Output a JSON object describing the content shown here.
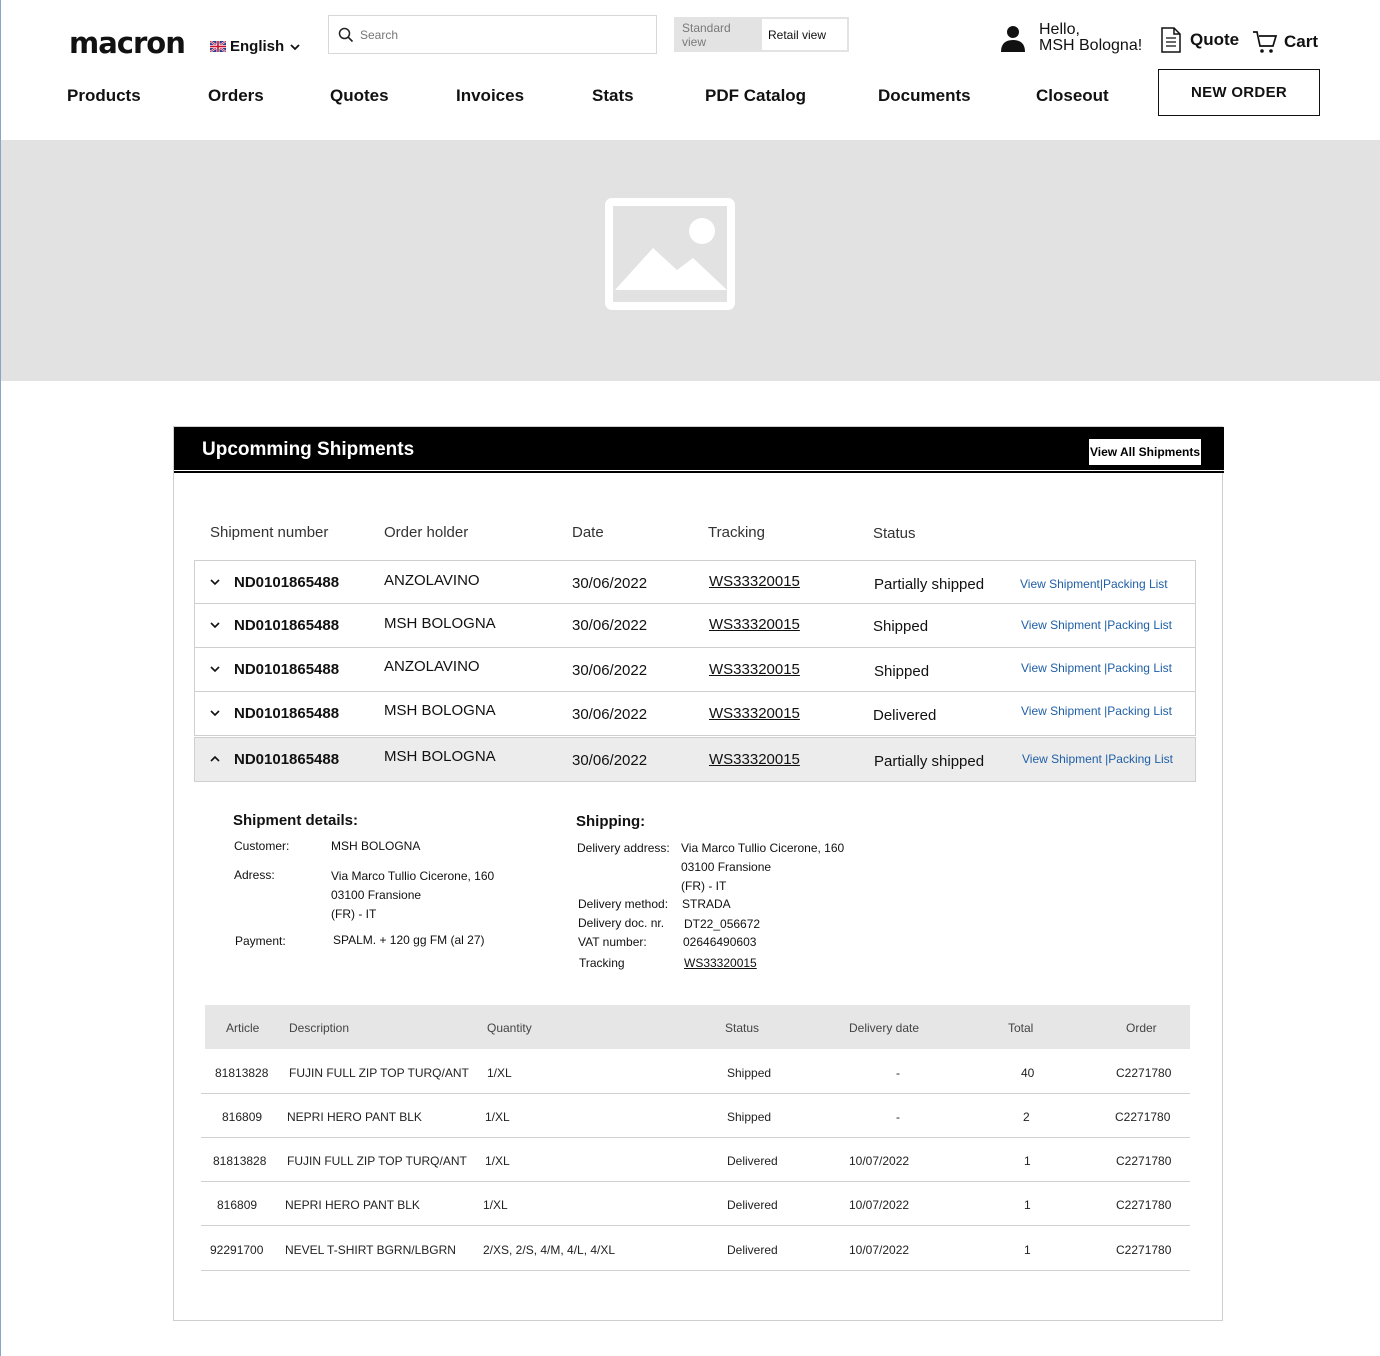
{
  "header": {
    "logo": "macron",
    "language": "English",
    "search_placeholder": "Search",
    "view_standard": "Standard view",
    "view_retail": "Retail view",
    "greeting_line1": "Hello,",
    "greeting_line2": "MSH Bologna!",
    "quote_label": "Quote",
    "cart_label": "Cart",
    "new_order_label": "NEW ORDER"
  },
  "nav": {
    "items": [
      "Products",
      "Orders",
      "Quotes",
      "Invoices",
      "Stats",
      "PDF Catalog",
      "Documents",
      "Closeout"
    ]
  },
  "shipments": {
    "title": "Upcomming Shipments",
    "view_all_label": "View All Shipments",
    "columns": [
      "Shipment number",
      "Order holder",
      "Date",
      "Tracking",
      "Status"
    ],
    "rows": [
      {
        "number": "ND0101865488",
        "holder": "ANZOLAVINO",
        "date": "30/06/2022",
        "tracking": "WS33320015",
        "status": "Partially shipped",
        "view_link": "View Shipment",
        "packing_link": "|Packing List"
      },
      {
        "number": "ND0101865488",
        "holder": "MSH BOLOGNA",
        "date": "30/06/2022",
        "tracking": "WS33320015",
        "status": "Shipped",
        "view_link": "View Shipment",
        "packing_link": "|Packing List"
      },
      {
        "number": "ND0101865488",
        "holder": "ANZOLAVINO",
        "date": "30/06/2022",
        "tracking": "WS33320015",
        "status": "Shipped",
        "view_link": "View Shipment",
        "packing_link": "|Packing List"
      },
      {
        "number": "ND0101865488",
        "holder": "MSH BOLOGNA",
        "date": "30/06/2022",
        "tracking": "WS33320015",
        "status": "Delivered",
        "view_link": "View Shipment",
        "packing_link": "|Packing List"
      },
      {
        "number": "ND0101865488",
        "holder": "MSH BOLOGNA",
        "date": "30/06/2022",
        "tracking": "WS33320015",
        "status": "Partially shipped",
        "view_link": "View Shipment",
        "packing_link": "|Packing List"
      }
    ],
    "details": {
      "title": "Shipment details:",
      "customer_label": "Customer:",
      "customer": "MSH BOLOGNA",
      "address_label": "Adress:",
      "address_line1": "Via Marco Tullio Cicerone, 160",
      "address_line2": "03100 Fransione",
      "address_line3": "(FR) - IT",
      "payment_label": "Payment:",
      "payment": "SPALM. + 120 gg FM (al 27)"
    },
    "shipping": {
      "title": "Shipping:",
      "delivery_address_label": "Delivery address:",
      "delivery_address_line1": "Via Marco Tullio Cicerone, 160",
      "delivery_address_line2": "03100 Fransione",
      "delivery_address_line3": "(FR) - IT",
      "delivery_method_label": "Delivery method:",
      "delivery_method": "STRADA",
      "delivery_doc_label": "Delivery doc. nr.",
      "delivery_doc": "DT22_056672",
      "vat_label": "VAT number:",
      "vat": "02646490603",
      "tracking_label": "Tracking",
      "tracking": "WS33320015"
    },
    "items": {
      "columns": [
        "Article",
        "Description",
        "Quantity",
        "Status",
        "Delivery date",
        "Total",
        "Order"
      ],
      "rows": [
        {
          "article": "81813828",
          "description": "FUJIN FULL ZIP TOP TURQ/ANT",
          "quantity": "1/XL",
          "status": "Shipped",
          "delivery_date": "-",
          "total": "40",
          "order": "C2271780"
        },
        {
          "article": "816809",
          "description": "NEPRI HERO PANT BLK",
          "quantity": "1/XL",
          "status": "Shipped",
          "delivery_date": "-",
          "total": "2",
          "order": "C2271780"
        },
        {
          "article": "81813828",
          "description": "FUJIN FULL ZIP TOP TURQ/ANT",
          "quantity": "1/XL",
          "status": "Delivered",
          "delivery_date": "10/07/2022",
          "total": "1",
          "order": "C2271780"
        },
        {
          "article": "816809",
          "description": "NEPRI HERO PANT BLK",
          "quantity": "1/XL",
          "status": "Delivered",
          "delivery_date": "10/07/2022",
          "total": "1",
          "order": "C2271780"
        },
        {
          "article": "92291700",
          "description": "NEVEL T-SHIRT BGRN/LBGRN",
          "quantity": "2/XS, 2/S, 4/M, 4/L, 4/XL",
          "status": "Delivered",
          "delivery_date": "10/07/2022",
          "total": "1",
          "order": "C2271780"
        }
      ]
    }
  }
}
